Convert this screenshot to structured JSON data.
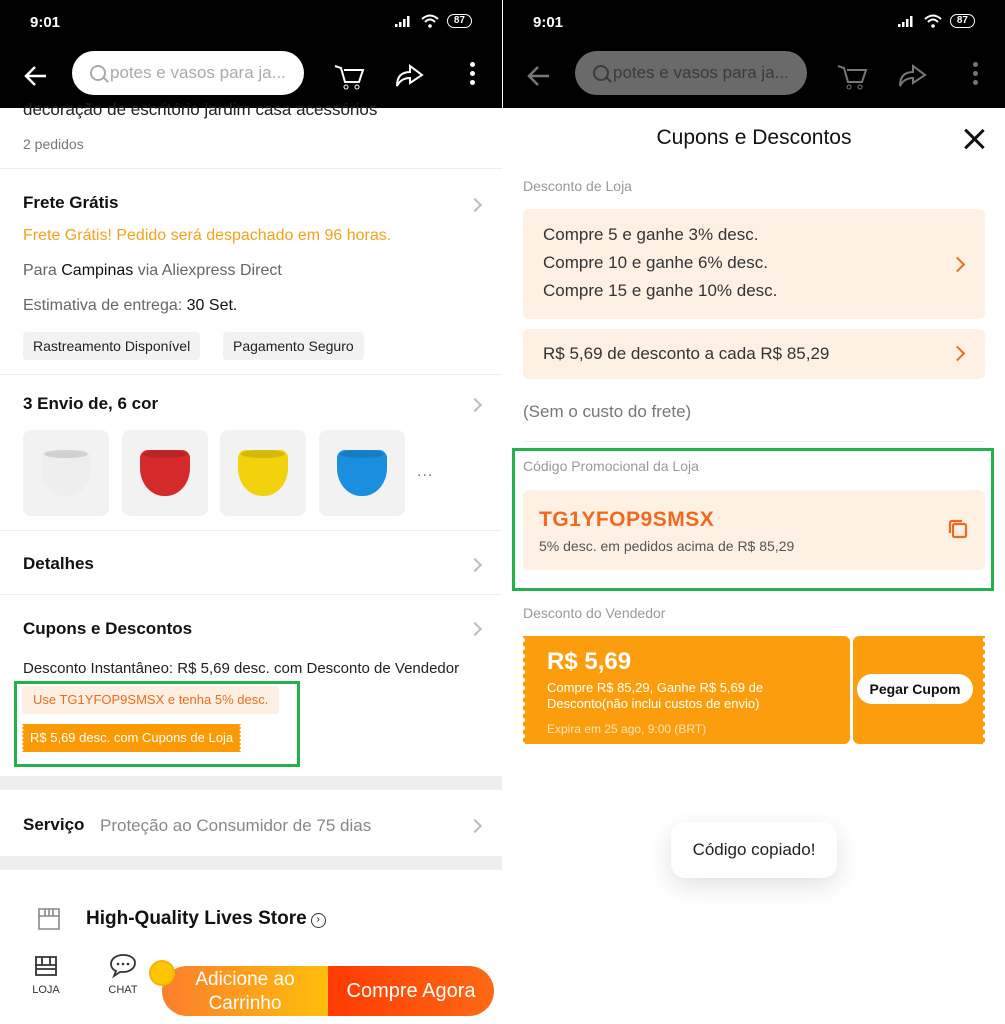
{
  "status_bar": {
    "time": "9:01",
    "battery": "87"
  },
  "top_bar": {
    "search_placeholder": "potes e vasos para ja..."
  },
  "product": {
    "title_fragment": "decoração de escritório jardim casa acessórios",
    "orders": "2 pedidos"
  },
  "shipping": {
    "title": "Frete Grátis",
    "promo": "Frete Grátis! Pedido será despachado em 96 horas.",
    "dest_prefix": "Para",
    "dest_city": "Campinas",
    "dest_suffix": "via Aliexpress Direct",
    "eta_label": "Estimativa de entrega:",
    "eta_value": "30 Set.",
    "chips": [
      "Rastreamento Disponível",
      "Pagamento Seguro"
    ]
  },
  "variants": {
    "title": "3 Envio de, 6 cor",
    "colors": [
      "#eeeeee",
      "#d42a2c",
      "#f2d20c",
      "#1a8fe0"
    ],
    "more": "..."
  },
  "details": {
    "title": "Detalhes"
  },
  "coupons": {
    "title": "Cupons e Descontos",
    "instant": "Desconto Instantâneo: R$ 5,69 desc. com Desconto de Vendedor",
    "code_badge": "Use TG1YFOP9SMSX e tenha 5% desc.",
    "store_badge": "R$ 5,69 desc. com Cupons de Loja"
  },
  "service": {
    "label": "Serviço",
    "value": "Proteção ao Consumidor de 75 dias"
  },
  "store": {
    "name": "High-Quality Lives Store",
    "arrow": "›"
  },
  "bottom_bar": {
    "store_label": "LOJA",
    "chat_label": "CHAT",
    "add_to_cart_line1": "Adicione ao",
    "add_to_cart_line2": "Carrinho",
    "buy_now": "Compre Agora"
  },
  "sheet": {
    "title": "Cupons e Descontos",
    "store_discount_label": "Desconto de Loja",
    "tiers": [
      "Compre 5 e ganhe 3% desc.",
      "Compre 10 e ganhe 6% desc.",
      "Compre 15 e ganhe 10% desc."
    ],
    "every_discount": "R$ 5,69 de desconto a cada R$ 85,29",
    "no_shipping_note": "(Sem o custo do frete)",
    "promo_code_label": "Código Promocional da Loja",
    "promo_code": "TG1YFOP9SMSX",
    "promo_code_desc": "5% desc. em pedidos acima de R$ 85,29",
    "seller_discount_label": "Desconto do Vendedor",
    "coupon_amount": "R$ 5,69",
    "coupon_desc": "Compre R$ 85,29, Ganhe R$ 5,69 de Desconto(não inclui custos de envio)",
    "coupon_expiry": "Expira em 25 ago, 9:00 (BRT)",
    "get_coupon": "Pegar Cupom",
    "toast": "Código copiado!"
  },
  "colors": {
    "accent_orange": "#ef6a1f",
    "highlight_green": "#22b14c",
    "coupon_orange": "#fc9d0d"
  }
}
